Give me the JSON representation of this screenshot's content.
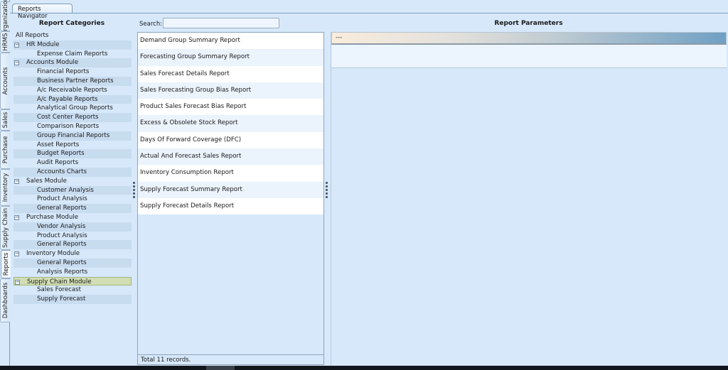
{
  "side_tabs": [
    {
      "label": "Organization",
      "active": false
    },
    {
      "label": "HRMS",
      "active": false
    },
    {
      "label": "Accounts",
      "active": false
    },
    {
      "label": "Sales",
      "active": false
    },
    {
      "label": "Purchase",
      "active": false
    },
    {
      "label": "Inventory",
      "active": false
    },
    {
      "label": "Supply Chain",
      "active": false
    },
    {
      "label": "Reports",
      "active": true
    },
    {
      "label": "Dashboards",
      "active": false
    }
  ],
  "top_tab": {
    "label": "Reports Navigator"
  },
  "categories": {
    "title": "Report Categories",
    "root": "All Reports",
    "rows": [
      {
        "label": "HR Module",
        "type": "module"
      },
      {
        "label": "Expense Claim Reports",
        "type": "leaf"
      },
      {
        "label": "Accounts Module",
        "type": "module"
      },
      {
        "label": "Financial Reports",
        "type": "leaf"
      },
      {
        "label": "Business Partner Reports",
        "type": "leaf"
      },
      {
        "label": "A/c Receivable Reports",
        "type": "leaf"
      },
      {
        "label": "A/c Payable Reports",
        "type": "leaf"
      },
      {
        "label": "Analytical Group Reports",
        "type": "leaf"
      },
      {
        "label": "Cost Center Reports",
        "type": "leaf"
      },
      {
        "label": "Comparison Reports",
        "type": "leaf"
      },
      {
        "label": "Group Financial Reports",
        "type": "leaf"
      },
      {
        "label": "Asset Reports",
        "type": "leaf"
      },
      {
        "label": "Budget Reports",
        "type": "leaf"
      },
      {
        "label": "Audit Reports",
        "type": "leaf"
      },
      {
        "label": "Accounts Charts",
        "type": "leaf"
      },
      {
        "label": "Sales Module",
        "type": "module"
      },
      {
        "label": "Customer Analysis",
        "type": "leaf"
      },
      {
        "label": "Product Analysis",
        "type": "leaf"
      },
      {
        "label": "General Reports",
        "type": "leaf"
      },
      {
        "label": "Purchase Module",
        "type": "module"
      },
      {
        "label": "Vendor Analysis",
        "type": "leaf"
      },
      {
        "label": "Product Analysis",
        "type": "leaf"
      },
      {
        "label": "General Reports",
        "type": "leaf"
      },
      {
        "label": "Inventory Module",
        "type": "module"
      },
      {
        "label": "General Reports",
        "type": "leaf"
      },
      {
        "label": "Analysis Reports",
        "type": "leaf"
      },
      {
        "label": "Supply Chain Module",
        "type": "module",
        "selected": true
      },
      {
        "label": "Sales Forecast",
        "type": "leaf"
      },
      {
        "label": "Supply Forecast",
        "type": "leaf"
      }
    ],
    "toggle_glyph": "−"
  },
  "search": {
    "label": "Search:",
    "value": "",
    "placeholder": ""
  },
  "reports": {
    "items": [
      "Demand Group Summary Report",
      "Forecasting Group Summary Report",
      "Sales Forecast Details Report",
      "Sales Forecasting Group Bias Report",
      "Product Sales Forecast Bias Report",
      "Excess & Obsolete Stock Report",
      "Days Of Forward Coverage (DFC)",
      "Actual And Forecast Sales Report",
      "Inventory Consumption Report",
      "Supply Forecast Summary Report",
      "Supply Forecast Details Report"
    ],
    "footer": "Total 11 records."
  },
  "parameters": {
    "title": "Report Parameters",
    "header_text": "---"
  }
}
